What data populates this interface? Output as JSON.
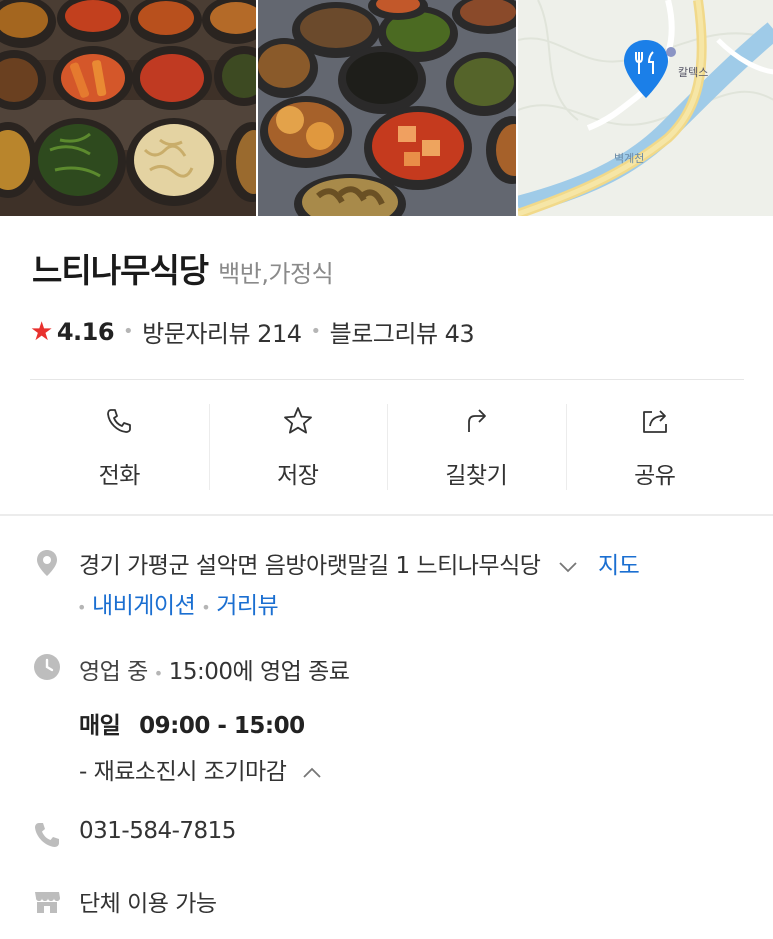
{
  "photos": [
    {
      "name": "banchan-photo-1"
    },
    {
      "name": "banchan-photo-2"
    },
    {
      "name": "map-thumbnail",
      "map_labels": [
        "칼텍스",
        "벽계천"
      ]
    }
  ],
  "place": {
    "name": "느티나무식당",
    "category": "백반,가정식",
    "rating": "4.16",
    "visitor_reviews": "방문자리뷰 214",
    "blog_reviews": "블로그리뷰 43"
  },
  "actions": [
    {
      "label": "전화",
      "icon": "phone-icon"
    },
    {
      "label": "저장",
      "icon": "star-outline-icon"
    },
    {
      "label": "길찾기",
      "icon": "directions-arrow-icon"
    },
    {
      "label": "공유",
      "icon": "share-icon"
    }
  ],
  "info": {
    "address": "경기 가평군 설악면 음방아랫말길 1 느티나무식당",
    "map_link": "지도",
    "navigation_link": "내비게이션",
    "street_view_link": "거리뷰",
    "status": "영업 중",
    "status_detail": "15:00에 영업 종료",
    "hours_day": "매일",
    "hours_time": "09:00 - 15:00",
    "hours_note": "- 재료소진시 조기마감",
    "phone": "031-584-7815",
    "group": "단체 이용 가능"
  },
  "colors": {
    "star": "#e8312e",
    "link": "#1b6fd1",
    "map_pin": "#1b7fe8",
    "icon_gray": "#bdbdbd"
  }
}
